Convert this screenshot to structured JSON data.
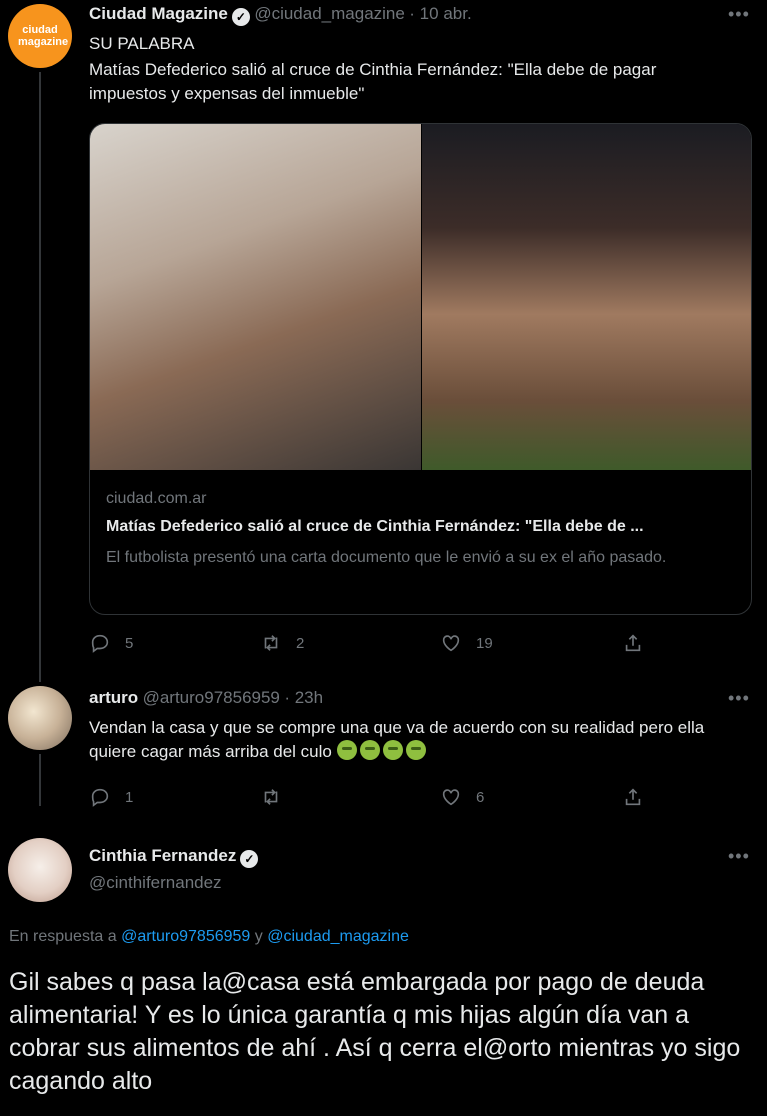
{
  "tweet1": {
    "name": "Ciudad Magazine",
    "handle": "@ciudad_magazine",
    "time": "· 10 abr.",
    "avatar_text": "ciudad magazine",
    "line1": "SU PALABRA",
    "line2": "Matías Defederico salió al cruce de Cinthia Fernández: \"Ella debe de pagar impuestos y expensas del inmueble\"",
    "card": {
      "domain": "ciudad.com.ar",
      "title": "Matías Defederico salió al cruce de Cinthia Fernández: \"Ella debe de ...",
      "description": "El futbolista presentó una carta documento que le envió a su ex el año pasado."
    },
    "stats": {
      "replies": "5",
      "retweets": "2",
      "likes": "19"
    }
  },
  "tweet2": {
    "name": "arturo",
    "handle": "@arturo97856959",
    "time": "· 23h",
    "text": "Vendan la casa y que se compre una que va de acuerdo con su realidad pero ella quiere cagar más arriba del culo",
    "stats": {
      "replies": "1",
      "likes": "6"
    }
  },
  "tweet3": {
    "name": "Cinthia Fernandez",
    "handle": "@cinthifernandez",
    "reply_prefix": "En respuesta a",
    "reply_user1": "@arturo97856959",
    "reply_and": "y",
    "reply_user2": "@ciudad_magazine",
    "text": "Gil sabes q pasa la@casa está embargada por pago de deuda alimentaria! Y es lo única garantía q mis hijas algún día van a cobrar sus alimentos de ahí . Así q cerra el@orto mientras yo sigo cagando alto"
  },
  "icons": [
    "verified-icon",
    "more-icon",
    "reply-icon",
    "retweet-icon",
    "like-icon",
    "share-icon",
    "nauseated-emoji"
  ],
  "colors": {
    "background": "#000000",
    "text": "#e7e9ea",
    "muted": "#71767b",
    "link": "#1d9bf0",
    "brand": "#f7941d"
  }
}
